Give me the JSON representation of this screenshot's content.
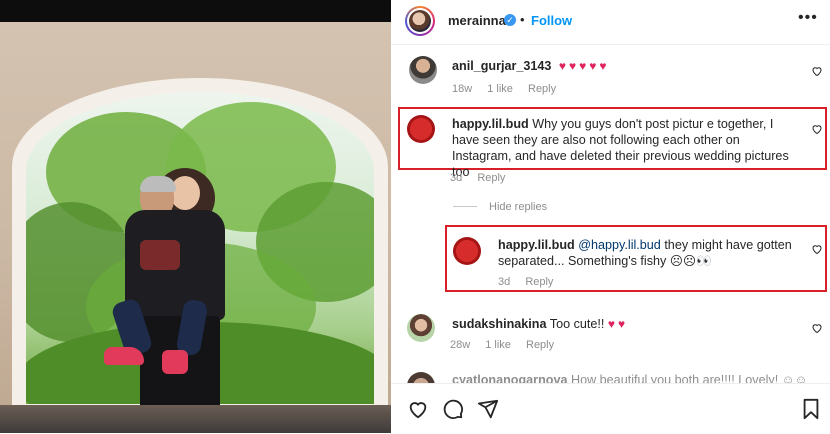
{
  "post": {
    "username": "merainna",
    "follow_label": "Follow",
    "separator": "•"
  },
  "comments": [
    {
      "username": "anil_gurjar_3143",
      "text": "♥♥♥♥♥",
      "time": "18w",
      "likes": "1 like",
      "reply": "Reply"
    },
    {
      "username": "happy.lil.bud",
      "text": "Why you guys don't post pictur e together, I have seen they are also not following each other on Instagram, and have deleted their previous wedding pictures too",
      "time": "3d",
      "reply": "Reply"
    },
    {
      "username": "happy.lil.bud",
      "mention": "@happy.lil.bud",
      "text": "they might have gotten separated... Something's fishy",
      "emojis": "☹☹👀",
      "time": "3d",
      "reply": "Reply"
    },
    {
      "username": "sudakshinakina",
      "text": "Too cute!!",
      "hearts": "♥♥",
      "time": "28w",
      "likes": "1 like",
      "reply": "Reply"
    },
    {
      "username": "cyatlonanogarnova",
      "text": "How beautiful you both are!!!! Lovely!",
      "emojis": "☺☺"
    }
  ],
  "hide_replies_label": "Hide replies",
  "colors": {
    "accent": "#0095f6",
    "highlight": "#d6202a",
    "heart": "#e0245e"
  },
  "icons": [
    "heart-icon",
    "comment-icon",
    "share-icon",
    "bookmark-icon",
    "more-icon",
    "verified-icon"
  ]
}
